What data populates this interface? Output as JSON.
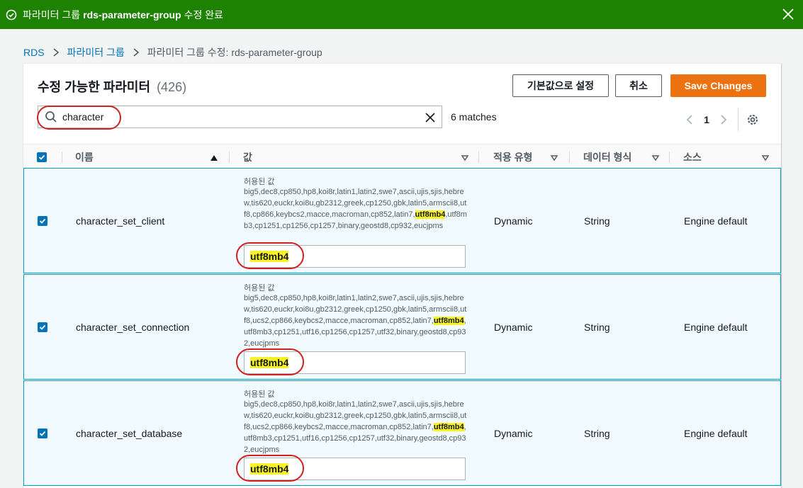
{
  "flash": {
    "prefix": "파라미터 그룹",
    "group_name": "rds-parameter-group",
    "suffix": "수정 완료"
  },
  "breadcrumb": {
    "items": [
      "RDS",
      "파라미터 그룹"
    ],
    "current": "파라미터 그룹 수정: rds-parameter-group"
  },
  "panel": {
    "title": "수정 가능한 파라미터",
    "count": "(426)",
    "buttons": {
      "default": "기본값으로 설정",
      "cancel": "취소",
      "save": "Save Changes"
    },
    "search": {
      "value": "character",
      "matches": "6 matches"
    },
    "pager": {
      "page": "1"
    }
  },
  "columns": {
    "name": "이름",
    "value": "값",
    "apply_type": "적용 유형",
    "data_type": "데이터 형식",
    "source": "소스"
  },
  "rows": [
    {
      "name": "character_set_client",
      "allowed_label": "허용된 값",
      "allowed_before": "big5,dec8,cp850,hp8,koi8r,latin1,latin2,swe7,ascii,ujis,sjis,hebrew,tis620,euckr,koi8u,gb2312,greek,cp1250,gbk,latin5,armscii8,utf8,cp866,keybcs2,macce,macroman,cp852,latin7,",
      "allowed_match": "utf8mb4",
      "allowed_after": ",utf8mb3,cp1251,cp1256,cp1257,binary,geostd8,cp932,eucjpms",
      "value": "utf8mb4",
      "apply_type": "Dynamic",
      "data_type": "String",
      "source": "Engine default"
    },
    {
      "name": "character_set_connection",
      "allowed_label": "허용된 값",
      "allowed_before": "big5,dec8,cp850,hp8,koi8r,latin1,latin2,swe7,ascii,ujis,sjis,hebrew,tis620,euckr,koi8u,gb2312,greek,cp1250,gbk,latin5,armscii8,utf8,ucs2,cp866,keybcs2,macce,macroman,cp852,latin7,",
      "allowed_match": "utf8mb4",
      "allowed_after": ",utf8mb3,cp1251,utf16,cp1256,cp1257,utf32,binary,geostd8,cp932,eucjpms",
      "value": "utf8mb4",
      "apply_type": "Dynamic",
      "data_type": "String",
      "source": "Engine default"
    },
    {
      "name": "character_set_database",
      "allowed_label": "허용된 값",
      "allowed_before": "big5,dec8,cp850,hp8,koi8r,latin1,latin2,swe7,ascii,ujis,sjis,hebrew,tis620,euckr,koi8u,gb2312,greek,cp1250,gbk,latin5,armscii8,utf8,ucs2,cp866,keybcs2,macce,macroman,cp852,latin7,",
      "allowed_match": "utf8mb4",
      "allowed_after": ",utf8mb3,cp1251,utf16,cp1256,cp1257,utf32,binary,geostd8,cp932,eucjpms",
      "value": "utf8mb4",
      "apply_type": "Dynamic",
      "data_type": "String",
      "source": "Engine default"
    }
  ]
}
